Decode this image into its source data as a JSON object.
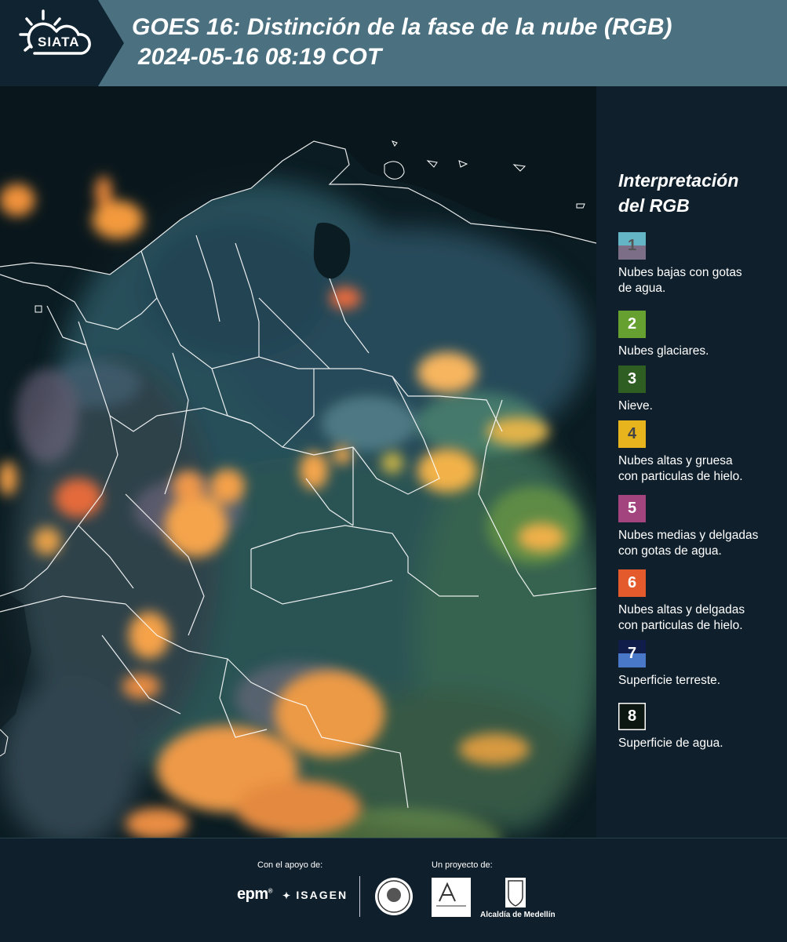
{
  "header": {
    "logo_text": "SIATA",
    "title": "GOES 16: Distinción de la fase de la nube (RGB)",
    "subtitle": "2024-05-16 08:19 COT",
    "bg_color": "#4b7180"
  },
  "legend": {
    "title_line1": "Interpretación",
    "title_line2": "del RGB",
    "items": [
      {
        "num": "1",
        "label_lines": [
          "Nubes bajas con gotas",
          "de agua."
        ],
        "color_top": "#64b6c6",
        "color_bottom": "#7d6e88",
        "num_color": "#555555"
      },
      {
        "num": "2",
        "label_lines": [
          "Nubes glaciares."
        ],
        "color": "#66a030",
        "num_color": "#ffffff"
      },
      {
        "num": "3",
        "label_lines": [
          "Nieve."
        ],
        "color": "#2e5e22",
        "num_color": "#ffffff"
      },
      {
        "num": "4",
        "label_lines": [
          "Nubes altas y gruesa",
          "con particulas de hielo."
        ],
        "color": "#e8b41e",
        "num_color": "#444444"
      },
      {
        "num": "5",
        "label_lines": [
          "Nubes medias y delgadas",
          "con gotas de agua."
        ],
        "color": "#a3447e",
        "num_color": "#ffffff"
      },
      {
        "num": "6",
        "label_lines": [
          "Nubes altas y delgadas",
          "con particulas de hielo."
        ],
        "color": "#e45a2c",
        "num_color": "#ffffff"
      },
      {
        "num": "7",
        "label_lines": [
          "Superficie terreste."
        ],
        "color_top": "#101c4a",
        "color_bottom": "#4a78c8",
        "num_color": "#ffffff"
      },
      {
        "num": "8",
        "label_lines": [
          "Superficie de agua."
        ],
        "color": "#0d1712",
        "num_color": "#ffffff",
        "border": "#ffffff"
      }
    ]
  },
  "footer": {
    "support_label": "Con el apoyo de:",
    "project_label": "Un proyecto de:",
    "epm": "epm",
    "epm_mark": "®",
    "isagen": "ISAGEN",
    "alcaldia": "Alcaldía de Medellín"
  }
}
